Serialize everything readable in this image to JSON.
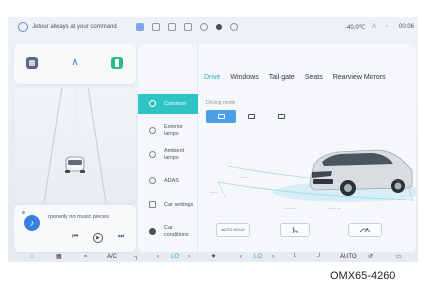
{
  "status_bar": {
    "assistant_text": "Jetour always at your command",
    "temperature": "-40.0℃",
    "indicator_a": "A",
    "indicator_b": "~",
    "time": "00:06"
  },
  "quick_controls": {
    "icons": [
      "square-icon",
      "chevron-up-icon",
      "green-app-icon"
    ]
  },
  "media": {
    "now_playing": "rporarily no music pieces",
    "prev_icon": "⏮",
    "play_icon": "▶",
    "next_icon": "⏭"
  },
  "settings_menu": {
    "items": [
      {
        "label": "Common",
        "icon": "star-icon",
        "active": true
      },
      {
        "label": "Exterior lamps",
        "icon": "lamp-icon",
        "active": false
      },
      {
        "label": "Ambient lamps",
        "icon": "ambient-icon",
        "active": false
      },
      {
        "label": "ADAS",
        "icon": "adas-icon",
        "active": false
      },
      {
        "label": "Car settings",
        "icon": "car-icon",
        "active": false
      },
      {
        "label": "Car conditions",
        "icon": "gear-icon",
        "active": false
      }
    ]
  },
  "tabs": [
    {
      "label": "Drive",
      "active": true
    },
    {
      "label": "Windows",
      "active": false
    },
    {
      "label": "Tail gate",
      "active": false
    },
    {
      "label": "Seats",
      "active": false
    },
    {
      "label": "Rearview Mirrors",
      "active": false
    }
  ],
  "driving_mode": {
    "label": "Driving mode",
    "options": [
      "auto-mode",
      "eco-mode",
      "sport-mode"
    ],
    "selected_index": 0
  },
  "bottom_buttons": {
    "auto_hold": "AUTO HOLD"
  },
  "dock": {
    "ac_label": "A/C",
    "left_temp": "LO",
    "right_temp": "LO",
    "auto_label": "AUTO"
  },
  "colors": {
    "accent": "#2ec4c4",
    "tab_active": "#2ea3d6",
    "mode_active": "#4b9ee8"
  },
  "caption": "OMX65-4260"
}
